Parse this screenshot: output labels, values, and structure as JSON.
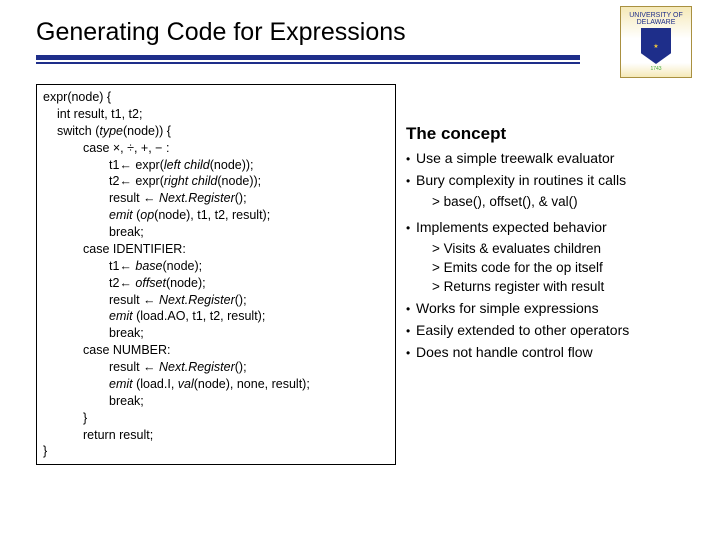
{
  "slide": {
    "title": "Generating Code for Expressions"
  },
  "logo": {
    "top": "UNIVERSITY OF",
    "bottom": "DELAWARE",
    "year": "1743"
  },
  "code": {
    "l1": "expr(node) {",
    "l2": "int result, t1, t2;",
    "l3a": "switch (",
    "l3b": "type",
    "l3c": "(node)) {",
    "l4": "case ×, ÷, +, − :",
    "l5a": "t1← expr(",
    "l5b": "left child",
    "l5c": "(node));",
    "l6a": "t2← expr(",
    "l6b": "right child",
    "l6c": "(node));",
    "l7a": "result ← ",
    "l7b": "Next.Register",
    "l7c": "();",
    "l8a": "emit ",
    "l8b": "(",
    "l8c": "op",
    "l8d": "(node), t1, t2, result);",
    "l9": "break;",
    "l10": "case IDENTIFIER:",
    "l11a": "t1← ",
    "l11b": "base",
    "l11c": "(node);",
    "l12a": "t2← ",
    "l12b": "offset",
    "l12c": "(node);",
    "l13a": "result ← ",
    "l13b": "Next.Register",
    "l13c": "();",
    "l14a": "emit ",
    "l14b": "(load.AO, t1, t2, result);",
    "l15": "break;",
    "l16": "case NUMBER:",
    "l17a": "result ← ",
    "l17b": "Next.Register",
    "l17c": "();",
    "l18a": "emit ",
    "l18b": "(load.I, ",
    "l18c": "val",
    "l18d": "(node), none, result);",
    "l19": "break;",
    "l20": "}",
    "l21": "return result;",
    "l22": "}"
  },
  "concept": {
    "heading": "The concept",
    "b1": "Use a simple treewalk evaluator",
    "b2": "Bury complexity in routines it calls",
    "s1": "> base(), offset(), & val()",
    "b3": "Implements expected behavior",
    "s2": "> Visits & evaluates children",
    "s3": "> Emits code for the op itself",
    "s4": "> Returns register with result",
    "b4": "Works for simple expressions",
    "b5": "Easily extended to other operators",
    "b6": "Does not handle control flow"
  }
}
